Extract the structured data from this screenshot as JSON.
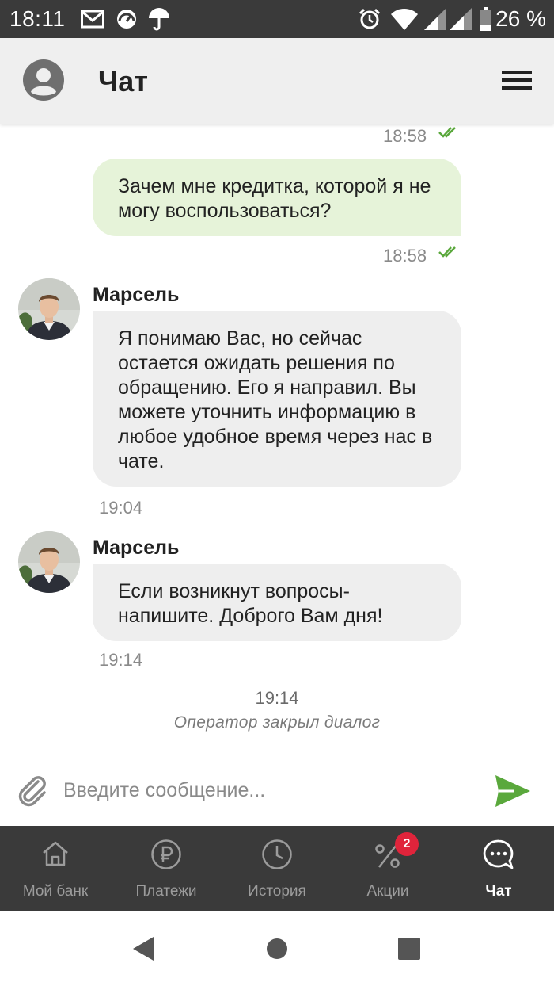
{
  "status_bar": {
    "time": "18:11",
    "battery": "26 %"
  },
  "header": {
    "title": "Чат"
  },
  "messages": [
    {
      "type": "outgoing",
      "time": "18:58"
    },
    {
      "type": "outgoing",
      "text": "Зачем мне кредитка, которой я не могу воспользоваться?",
      "time": "18:58"
    },
    {
      "type": "incoming",
      "author": "Марсель",
      "text": "Я понимаю Вас, но сейчас остается ожидать решения по обращению. Его я направил. Вы можете уточнить информацию в любое удобное время через нас в чате.",
      "time": "19:04"
    },
    {
      "type": "incoming",
      "author": "Марсель",
      "text": "Если возникнут вопросы- напишите. Доброго Вам дня!",
      "time": "19:14"
    }
  ],
  "system_message": {
    "time": "19:14",
    "text": "Оператор закрыл диалог"
  },
  "input": {
    "placeholder": "Введите сообщение..."
  },
  "nav": [
    {
      "label": "Мой банк",
      "icon": "home-icon"
    },
    {
      "label": "Платежи",
      "icon": "ruble-icon"
    },
    {
      "label": "История",
      "icon": "clock-icon"
    },
    {
      "label": "Акции",
      "icon": "percent-icon",
      "badge": "2"
    },
    {
      "label": "Чат",
      "icon": "chat-icon",
      "active": true
    }
  ],
  "colors": {
    "accent": "#5aa83c",
    "outgoing_bubble": "#e6f3d9",
    "incoming_bubble": "#eeeeee",
    "nav_bg": "#3a3a3a",
    "badge": "#e0243b"
  }
}
